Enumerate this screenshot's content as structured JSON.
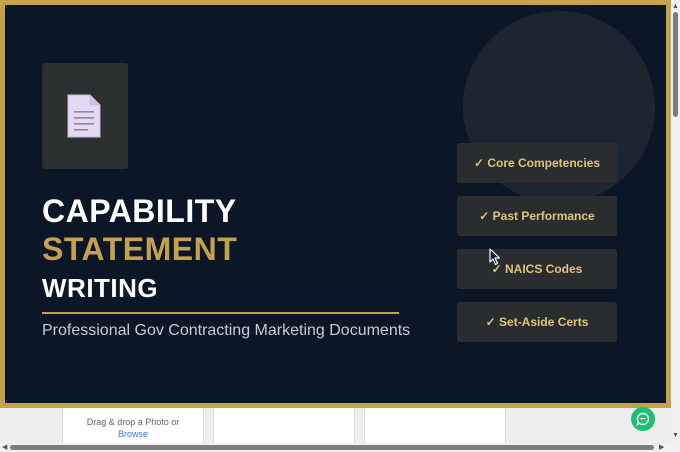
{
  "hero": {
    "title_line1": "CAPABILITY",
    "title_line2": "STATEMENT",
    "title_line3": "WRITING",
    "subtitle": "Professional Gov Contracting Marketing Documents",
    "features": [
      "✓ Core Competencies",
      "✓ Past Performance",
      "✓ NAICS Codes",
      "✓ Set-Aside Certs"
    ],
    "icon": "document-icon"
  },
  "upload": {
    "drag_text": "Drag & drop a Photo or",
    "browse_label": "Browse"
  },
  "chat": {
    "icon": "chat-icon"
  },
  "colors": {
    "background": "#0b1627",
    "gold": "#c5a04d",
    "feature_text": "#e3c27a",
    "chat_green": "#1dbf73"
  }
}
